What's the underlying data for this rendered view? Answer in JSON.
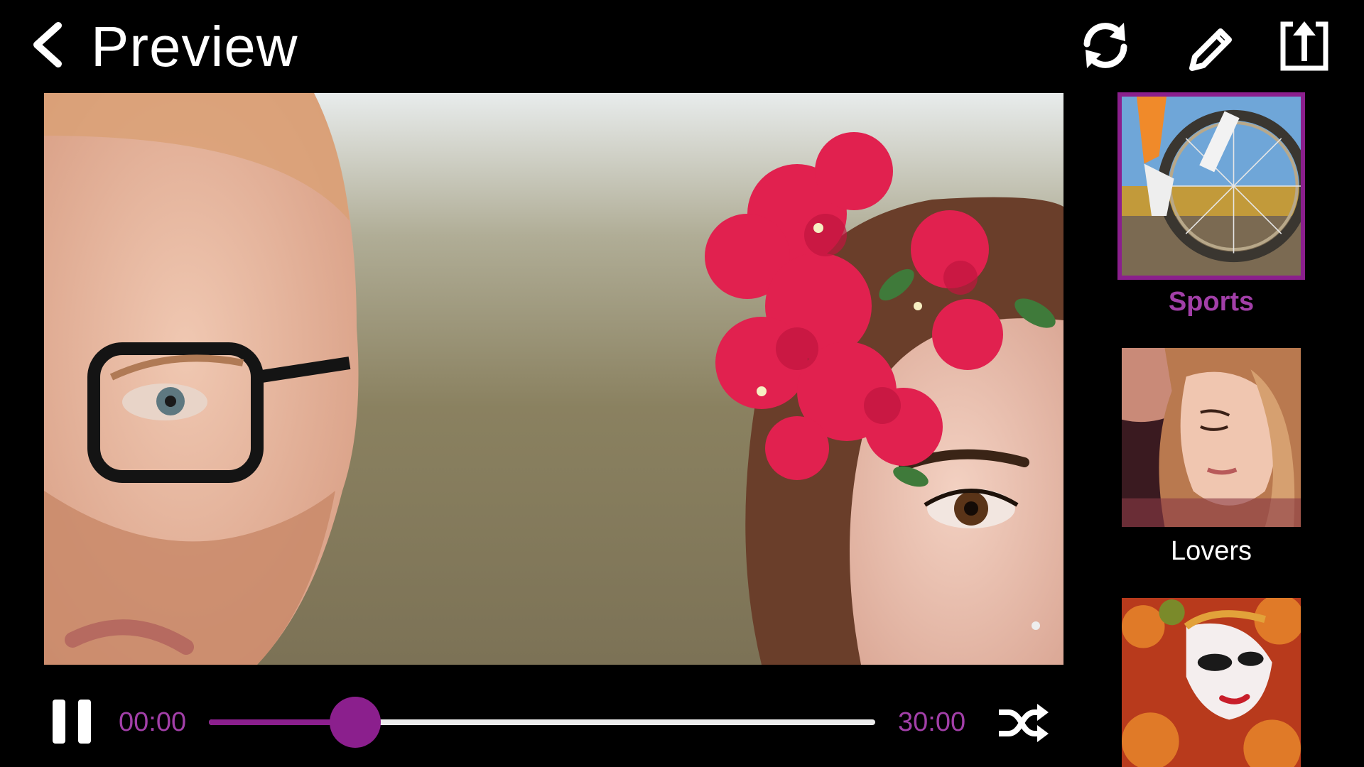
{
  "header": {
    "title": "Preview",
    "back_icon": "chevron-left-icon",
    "actions": [
      {
        "name": "refresh",
        "icon": "refresh-icon"
      },
      {
        "name": "edit",
        "icon": "pencil-icon"
      },
      {
        "name": "share",
        "icon": "share-upload-icon"
      }
    ]
  },
  "player": {
    "current_time": "00:00",
    "total_time": "30:00",
    "progress": 0.22,
    "state": "playing",
    "pause_icon": "pause-icon",
    "shuffle_icon": "shuffle-icon"
  },
  "themes": [
    {
      "label": "Sports",
      "selected": true,
      "thumbnail": "bicycle-wheel-photo"
    },
    {
      "label": "Lovers",
      "selected": false,
      "thumbnail": "couple-photo"
    },
    {
      "label": "",
      "selected": false,
      "thumbnail": "carnival-mask-photo"
    }
  ],
  "colors": {
    "background": "#000000",
    "accent": "#8b1f8d",
    "accent_text": "#a23fa8",
    "text": "#ffffff",
    "track": "#ececec"
  }
}
